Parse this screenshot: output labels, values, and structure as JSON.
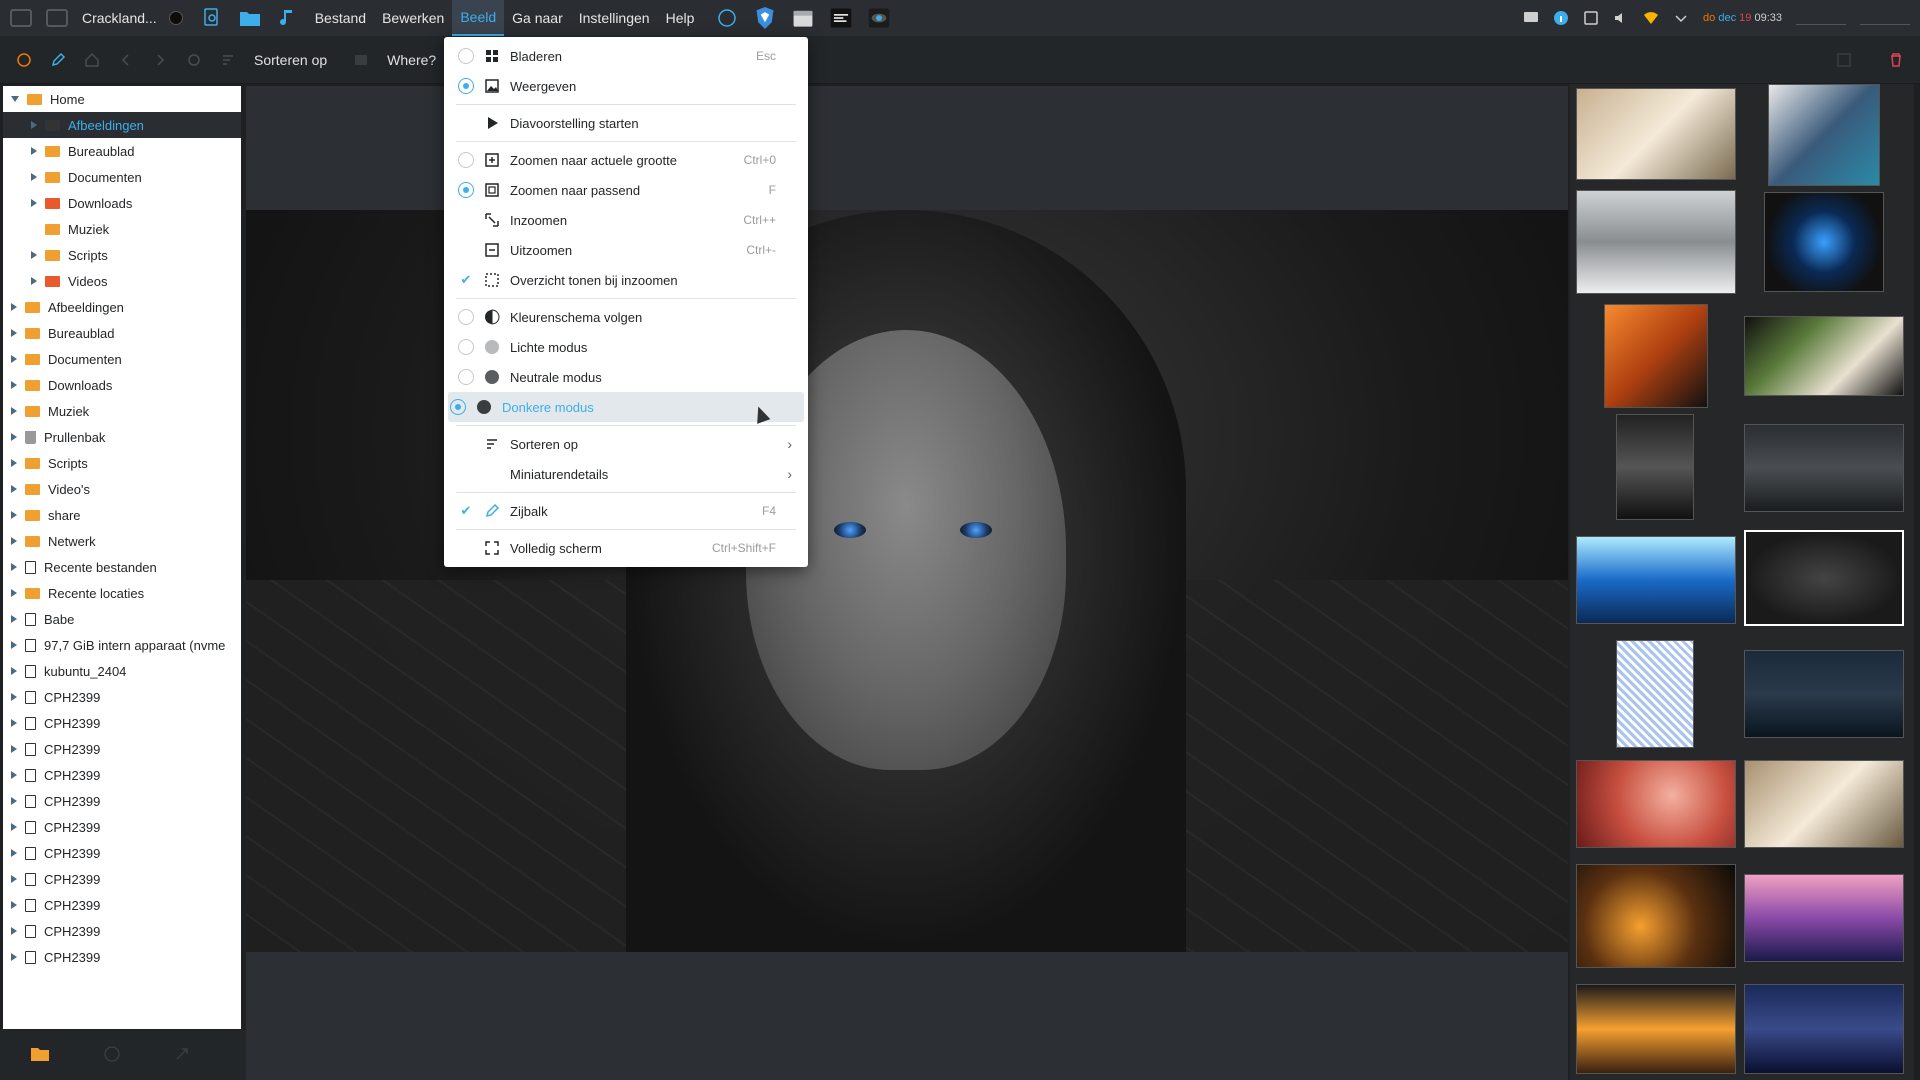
{
  "topbar": {
    "app_title": "Crackland...",
    "menus": [
      "Bestand",
      "Bewerken",
      "Beeld",
      "Ga naar",
      "Instellingen",
      "Help"
    ],
    "active_menu": "Beeld",
    "clock": {
      "prefix": "do",
      "day": "dec",
      "num": "19",
      "time": "09:33"
    }
  },
  "toolbar": {
    "sort_label": "Sorteren op",
    "where_label": "Where?"
  },
  "sidebar": {
    "tree": [
      {
        "label": "Home",
        "level": 0,
        "arrow": "down",
        "icon": "orange",
        "selected": false
      },
      {
        "label": "Afbeeldingen",
        "level": 1,
        "arrow": "right",
        "icon": "dark",
        "selected": true
      },
      {
        "label": "Bureaublad",
        "level": 1,
        "arrow": "right",
        "icon": "orange",
        "selected": false
      },
      {
        "label": "Documenten",
        "level": 1,
        "arrow": "right",
        "icon": "orange",
        "selected": false
      },
      {
        "label": "Downloads",
        "level": 1,
        "arrow": "right",
        "icon": "red",
        "selected": false
      },
      {
        "label": "Muziek",
        "level": 1,
        "arrow": "none",
        "icon": "orange",
        "selected": false
      },
      {
        "label": "Scripts",
        "level": 1,
        "arrow": "right",
        "icon": "orange",
        "selected": false
      },
      {
        "label": "Videos",
        "level": 1,
        "arrow": "right",
        "icon": "red",
        "selected": false
      },
      {
        "label": "Afbeeldingen",
        "level": 0,
        "arrow": "right",
        "icon": "orange",
        "selected": false
      },
      {
        "label": "Bureaublad",
        "level": 0,
        "arrow": "right",
        "icon": "orange",
        "selected": false
      },
      {
        "label": "Documenten",
        "level": 0,
        "arrow": "right",
        "icon": "orange",
        "selected": false
      },
      {
        "label": "Downloads",
        "level": 0,
        "arrow": "right",
        "icon": "orange",
        "selected": false
      },
      {
        "label": "Muziek",
        "level": 0,
        "arrow": "right",
        "icon": "orange",
        "selected": false
      },
      {
        "label": "Prullenbak",
        "level": 0,
        "arrow": "right",
        "icon": "trash",
        "selected": false
      },
      {
        "label": "Scripts",
        "level": 0,
        "arrow": "right",
        "icon": "orange",
        "selected": false
      },
      {
        "label": "Video's",
        "level": 0,
        "arrow": "right",
        "icon": "orange",
        "selected": false
      },
      {
        "label": "share",
        "level": 0,
        "arrow": "right",
        "icon": "orange",
        "selected": false
      },
      {
        "label": "Netwerk",
        "level": 0,
        "arrow": "right",
        "icon": "orange",
        "selected": false
      },
      {
        "label": "Recente bestanden",
        "level": 0,
        "arrow": "right",
        "icon": "drive",
        "selected": false
      },
      {
        "label": "Recente locaties",
        "level": 0,
        "arrow": "right",
        "icon": "orange",
        "selected": false
      },
      {
        "label": "Babe",
        "level": 0,
        "arrow": "right",
        "icon": "drive",
        "selected": false
      },
      {
        "label": "97,7 GiB intern apparaat (nvme",
        "level": 0,
        "arrow": "right",
        "icon": "drive",
        "selected": false
      },
      {
        "label": "kubuntu_2404",
        "level": 0,
        "arrow": "right",
        "icon": "drive",
        "selected": false
      },
      {
        "label": "CPH2399",
        "level": 0,
        "arrow": "right",
        "icon": "drive",
        "selected": false
      },
      {
        "label": "CPH2399",
        "level": 0,
        "arrow": "right",
        "icon": "drive",
        "selected": false
      },
      {
        "label": "CPH2399",
        "level": 0,
        "arrow": "right",
        "icon": "drive",
        "selected": false
      },
      {
        "label": "CPH2399",
        "level": 0,
        "arrow": "right",
        "icon": "drive",
        "selected": false
      },
      {
        "label": "CPH2399",
        "level": 0,
        "arrow": "right",
        "icon": "drive",
        "selected": false
      },
      {
        "label": "CPH2399",
        "level": 0,
        "arrow": "right",
        "icon": "drive",
        "selected": false
      },
      {
        "label": "CPH2399",
        "level": 0,
        "arrow": "right",
        "icon": "drive",
        "selected": false
      },
      {
        "label": "CPH2399",
        "level": 0,
        "arrow": "right",
        "icon": "drive",
        "selected": false
      },
      {
        "label": "CPH2399",
        "level": 0,
        "arrow": "right",
        "icon": "drive",
        "selected": false
      },
      {
        "label": "CPH2399",
        "level": 0,
        "arrow": "right",
        "icon": "drive",
        "selected": false
      },
      {
        "label": "CPH2399",
        "level": 0,
        "arrow": "right",
        "icon": "drive",
        "selected": false
      }
    ]
  },
  "menu": {
    "items": [
      {
        "type": "item",
        "marker": "radio-off",
        "icon": "browse-icon",
        "label": "Bladeren",
        "shortcut": "Esc"
      },
      {
        "type": "item",
        "marker": "radio-on",
        "icon": "image-icon",
        "label": "Weergeven",
        "shortcut": ""
      },
      {
        "type": "sep"
      },
      {
        "type": "item",
        "marker": "none",
        "icon": "play-icon",
        "label": "Diavoorstelling starten",
        "shortcut": ""
      },
      {
        "type": "sep"
      },
      {
        "type": "item",
        "marker": "radio-off",
        "icon": "zoom-original-icon",
        "label": "Zoomen naar actuele grootte",
        "shortcut": "Ctrl+0"
      },
      {
        "type": "item",
        "marker": "radio-on",
        "icon": "zoom-fit-icon",
        "label": "Zoomen naar passend",
        "shortcut": "F"
      },
      {
        "type": "item",
        "marker": "none",
        "icon": "zoom-in-icon",
        "label": "Inzoomen",
        "shortcut": "Ctrl++"
      },
      {
        "type": "item",
        "marker": "none",
        "icon": "zoom-out-icon",
        "label": "Uitzoomen",
        "shortcut": "Ctrl+-"
      },
      {
        "type": "item",
        "marker": "check",
        "icon": "overview-icon",
        "label": "Overzicht tonen bij inzoomen",
        "shortcut": ""
      },
      {
        "type": "sep"
      },
      {
        "type": "item",
        "marker": "radio-off",
        "icon": "color-scheme-icon",
        "label": "Kleurenschema volgen",
        "shortcut": ""
      },
      {
        "type": "item",
        "marker": "radio-off",
        "icon": "light-mode-icon",
        "label": "Lichte modus",
        "shortcut": ""
      },
      {
        "type": "item",
        "marker": "radio-off",
        "icon": "neutral-mode-icon",
        "label": "Neutrale modus",
        "shortcut": ""
      },
      {
        "type": "item",
        "marker": "radio-on",
        "icon": "dark-mode-icon",
        "label": "Donkere modus",
        "shortcut": "",
        "highlight": true
      },
      {
        "type": "sep"
      },
      {
        "type": "item",
        "marker": "none",
        "icon": "sort-icon",
        "label": "Sorteren op",
        "shortcut": "",
        "submenu": true
      },
      {
        "type": "item",
        "marker": "none",
        "icon": "",
        "label": "Miniaturendetails",
        "shortcut": "",
        "submenu": true
      },
      {
        "type": "sep"
      },
      {
        "type": "item",
        "marker": "check",
        "icon": "sidebar-icon",
        "label": "Zijbalk",
        "shortcut": "F4"
      },
      {
        "type": "sep"
      },
      {
        "type": "item",
        "marker": "none",
        "icon": "fullscreen-icon",
        "label": "Volledig scherm",
        "shortcut": "Ctrl+Shift+F"
      }
    ]
  },
  "colors": {
    "accent": "#3daee9",
    "panel": "#2a2d31",
    "menu_bg": "#ffffff"
  }
}
